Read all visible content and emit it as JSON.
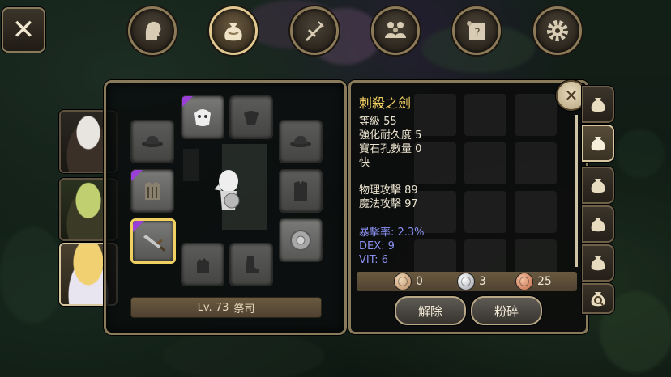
{
  "top_nav": {
    "items": [
      {
        "name": "character",
        "icon": "head-profile-icon",
        "active": false
      },
      {
        "name": "inventory",
        "icon": "bag-icon",
        "active": true
      },
      {
        "name": "skills",
        "icon": "crossed-sword-icon",
        "active": false
      },
      {
        "name": "party",
        "icon": "group-icon",
        "active": false
      },
      {
        "name": "quests",
        "icon": "scroll-icon",
        "active": false
      },
      {
        "name": "settings",
        "icon": "gear-icon",
        "active": false
      }
    ]
  },
  "portraits": [
    {
      "name": "white-haired-hero",
      "active": false
    },
    {
      "name": "green-haired-hero",
      "active": false
    },
    {
      "name": "blonde-priest",
      "active": true
    }
  ],
  "equipment": {
    "level_label": "Lv. 73",
    "class_label": "祭司",
    "slots": [
      {
        "id": "hat",
        "icon": "hat-icon",
        "filled": false,
        "rare": false
      },
      {
        "id": "headgear",
        "icon": "mask-icon",
        "filled": true,
        "rare": true
      },
      {
        "id": "cape",
        "icon": "cape-icon",
        "filled": false,
        "rare": false
      },
      {
        "id": "accessory",
        "icon": "hat-icon",
        "filled": false,
        "rare": false
      },
      {
        "id": "armor",
        "icon": "armor-icon",
        "filled": true,
        "rare": true
      },
      {
        "id": "coat",
        "icon": "coat-icon",
        "filled": false,
        "rare": false
      },
      {
        "id": "weapon",
        "icon": "sword-icon",
        "filled": true,
        "rare": true,
        "selected": true
      },
      {
        "id": "shield",
        "icon": "shield-icon",
        "filled": true,
        "rare": false
      },
      {
        "id": "gloves",
        "icon": "glove-icon",
        "filled": false,
        "rare": false
      },
      {
        "id": "boots",
        "icon": "boot-icon",
        "filled": false,
        "rare": false
      }
    ]
  },
  "item_detail": {
    "name": "刺殺之劍",
    "stats": {
      "level": "等級 55",
      "durability": "強化耐久度 5",
      "sockets": "寶石孔數量 0",
      "speed": "快",
      "phys_atk": "物理攻擊 89",
      "mag_atk": "魔法攻擊 97"
    },
    "bonus": {
      "crit": "暴擊率: 2.3%",
      "dex": "DEX: 9",
      "vit": "VIT: 6"
    },
    "currency": {
      "bronze": "0",
      "silver": "3",
      "copper": "25"
    },
    "buttons": {
      "unequip": "解除",
      "smash": "粉碎"
    }
  },
  "bag_tabs": [
    {
      "name": "bag-1",
      "active": false,
      "icon": "bag-icon"
    },
    {
      "name": "bag-2",
      "active": true,
      "icon": "bag-icon"
    },
    {
      "name": "bag-3",
      "active": false,
      "icon": "bag-icon"
    },
    {
      "name": "bag-4",
      "active": false,
      "icon": "bag-icon"
    },
    {
      "name": "bag-5",
      "active": false,
      "icon": "bag-icon"
    },
    {
      "name": "bag-6",
      "active": false,
      "icon": "bag-icon"
    },
    {
      "name": "bag-search",
      "active": false,
      "icon": "bag-search-icon"
    }
  ],
  "colors": {
    "gold_text": "#f0d060",
    "bonus_text": "#8a90f0",
    "rare_corner": "#9a3fd8",
    "frame": "#8a7a5c"
  }
}
